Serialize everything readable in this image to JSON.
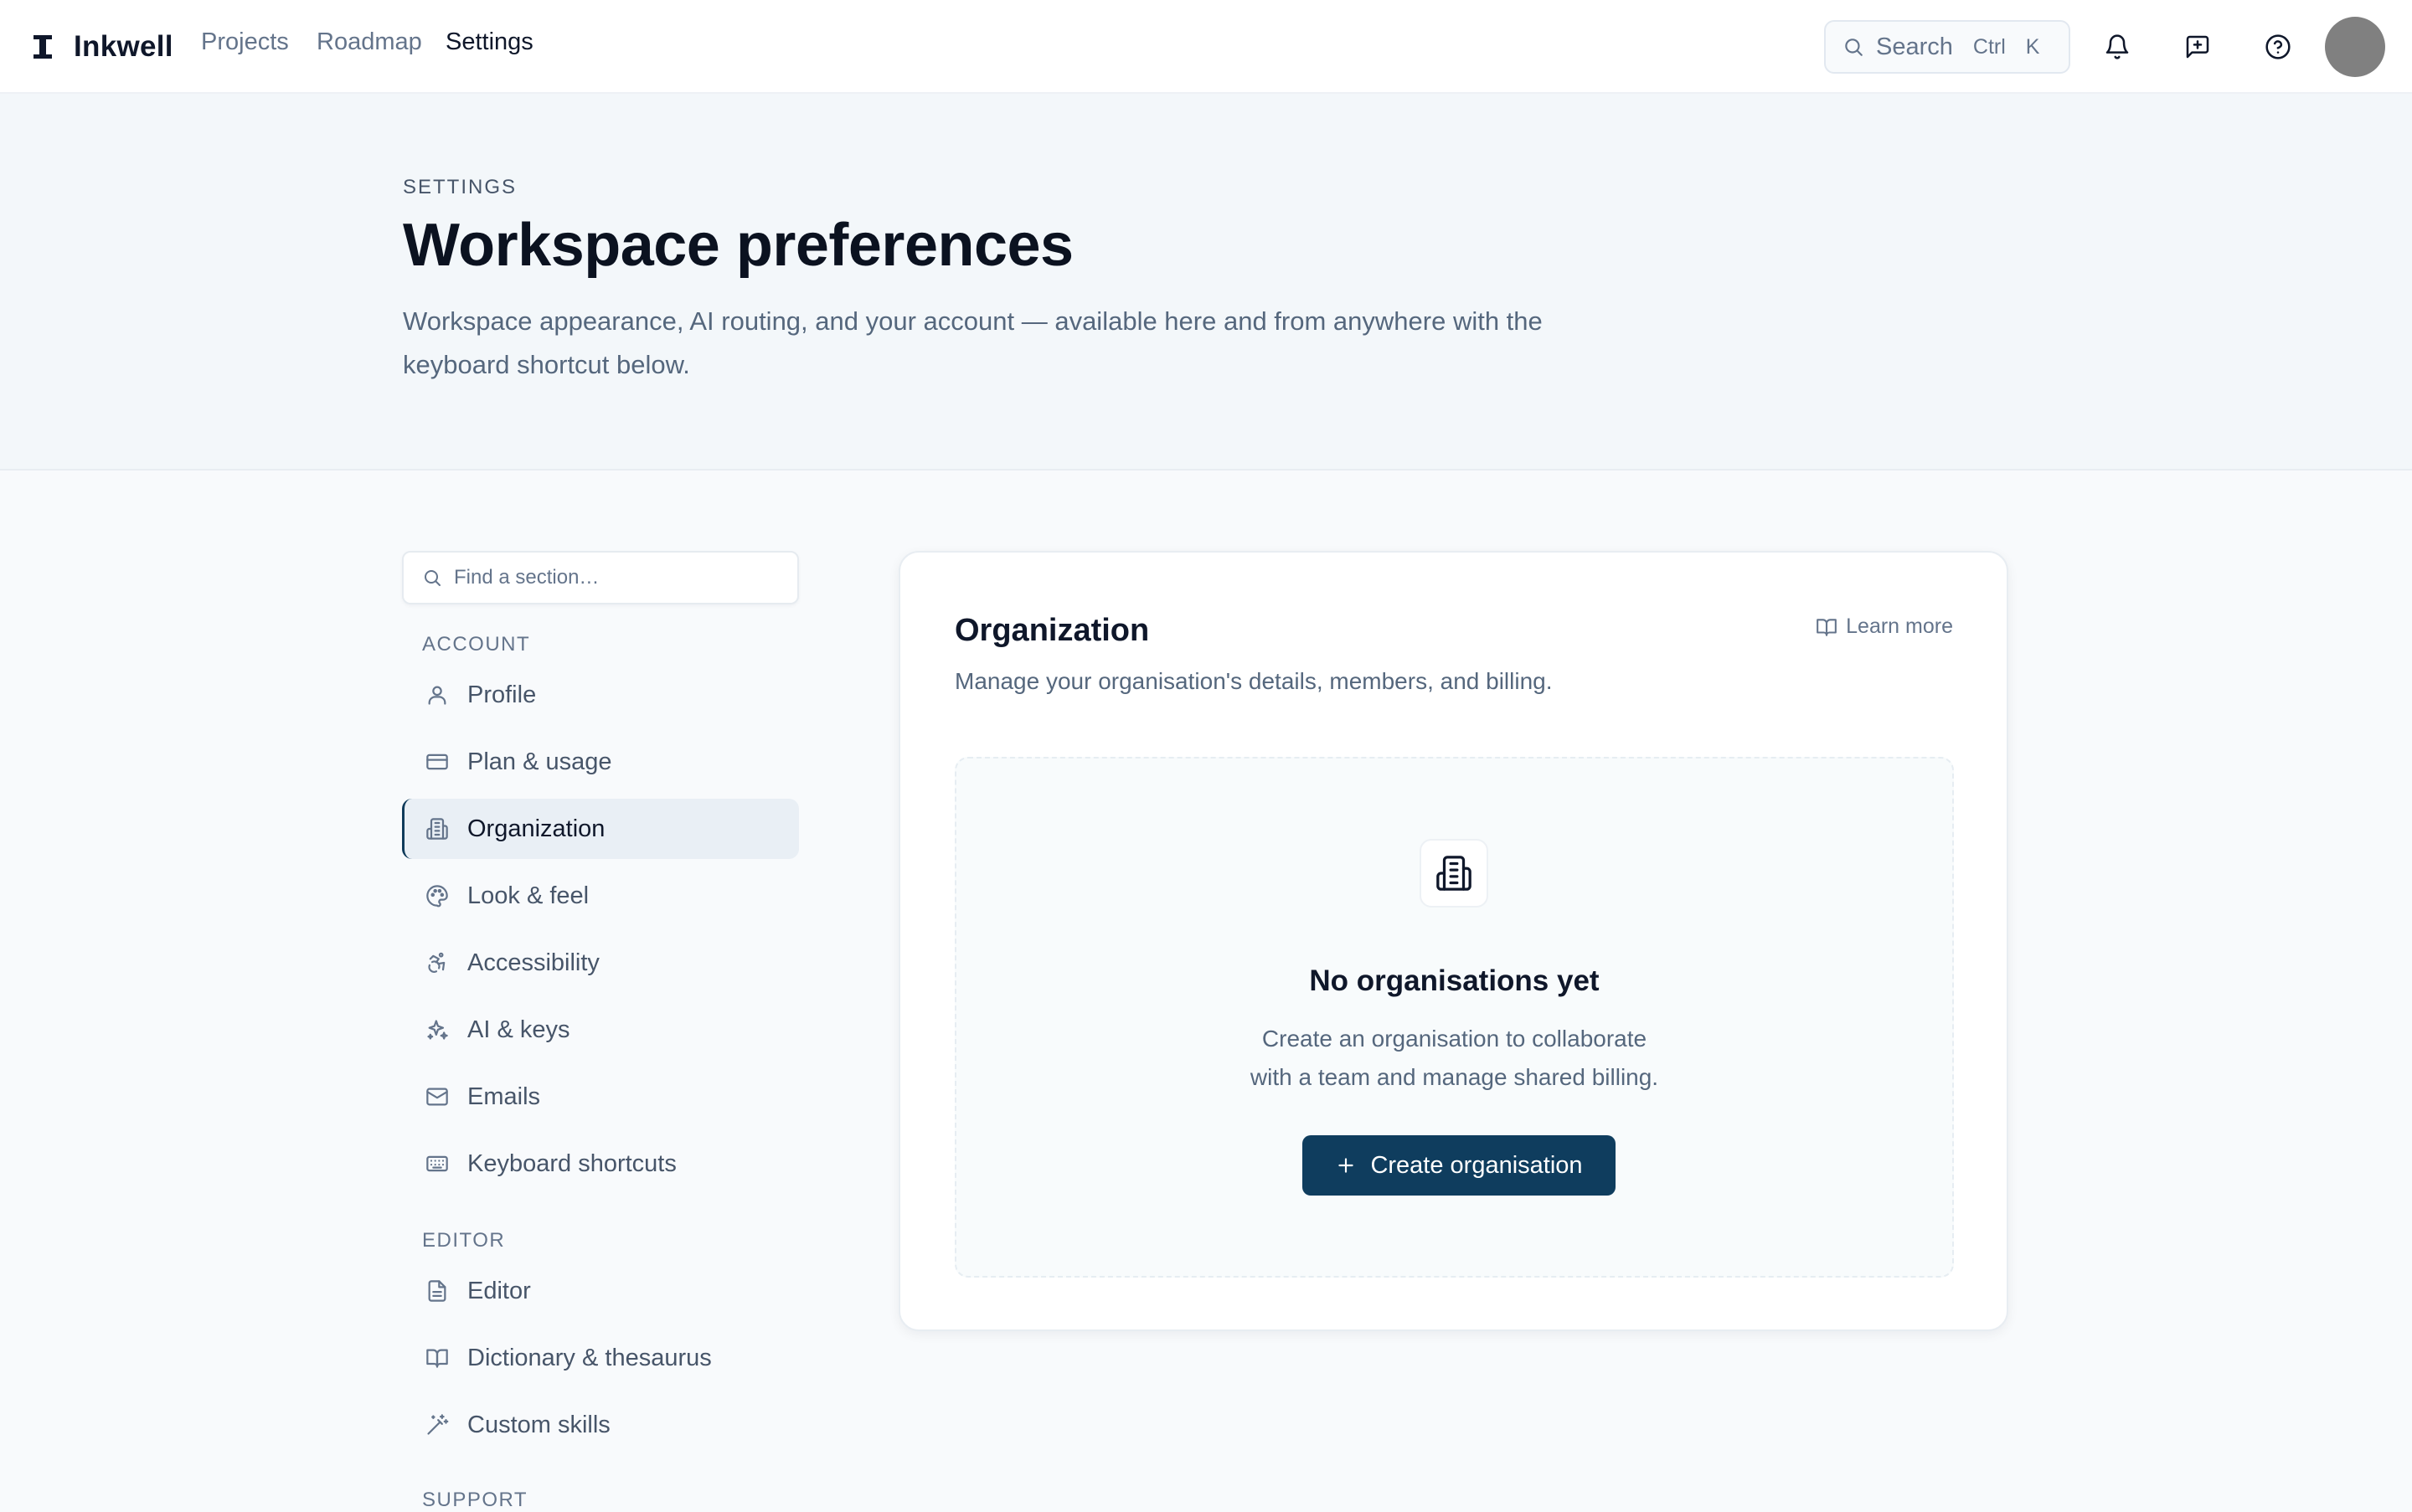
{
  "app": {
    "name": "Inkwell"
  },
  "topnav": {
    "items": [
      "Projects",
      "Roadmap",
      "Settings"
    ],
    "active_index": 2
  },
  "search": {
    "label": "Search",
    "shortcut_modifier": "Ctrl",
    "shortcut_key": "K"
  },
  "header_icons": [
    "bell-icon",
    "feedback-icon",
    "help-icon"
  ],
  "hero": {
    "eyebrow": "SETTINGS",
    "title": "Workspace preferences",
    "subtitle": "Workspace appearance, AI routing, and your account — available here and from anywhere with the keyboard shortcut below."
  },
  "sidebar": {
    "search_placeholder": "Find a section…",
    "groups": [
      {
        "label": "ACCOUNT",
        "items": [
          {
            "label": "Profile",
            "icon": "user-icon"
          },
          {
            "label": "Plan & usage",
            "icon": "credit-card-icon"
          },
          {
            "label": "Organization",
            "icon": "building-icon",
            "active": true
          },
          {
            "label": "Look & feel",
            "icon": "palette-icon"
          },
          {
            "label": "Accessibility",
            "icon": "accessibility-icon"
          },
          {
            "label": "AI & keys",
            "icon": "sparkles-icon"
          },
          {
            "label": "Emails",
            "icon": "mail-icon"
          },
          {
            "label": "Keyboard shortcuts",
            "icon": "keyboard-icon"
          }
        ]
      },
      {
        "label": "EDITOR",
        "items": [
          {
            "label": "Editor",
            "icon": "document-icon"
          },
          {
            "label": "Dictionary & thesaurus",
            "icon": "book-icon"
          },
          {
            "label": "Custom skills",
            "icon": "magic-wand-icon"
          }
        ]
      },
      {
        "label": "SUPPORT",
        "items": []
      }
    ]
  },
  "panel": {
    "title": "Organization",
    "description": "Manage your organisation's details, members, and billing.",
    "learn_more": "Learn more",
    "empty": {
      "title": "No organisations yet",
      "line1": "Create an organisation to collaborate",
      "line2": "with a team and manage shared billing.",
      "button": "Create organisation"
    }
  },
  "colors": {
    "accent": "#0f3d5e",
    "text": "#0f172a",
    "muted": "#64748b",
    "hero_bg": "#f3f7fa",
    "page_bg": "#f8fafc",
    "active_item_bg": "#e9eff5"
  }
}
